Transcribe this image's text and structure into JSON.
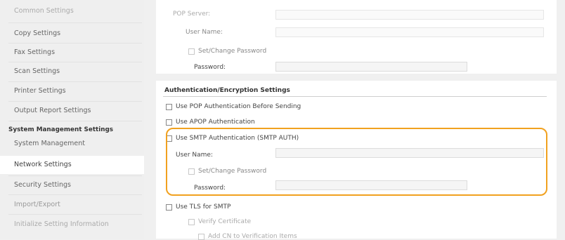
{
  "sidebar": {
    "items": [
      {
        "label": "Common Settings"
      },
      {
        "label": "Copy Settings"
      },
      {
        "label": "Fax Settings"
      },
      {
        "label": "Scan Settings"
      },
      {
        "label": "Printer Settings"
      },
      {
        "label": "Output Report Settings"
      }
    ],
    "section_header": "System Management Settings",
    "sub_items": [
      {
        "label": "System Management"
      },
      {
        "label": "Network Settings"
      },
      {
        "label": "Security Settings"
      },
      {
        "label": "Import/Export"
      },
      {
        "label": "Initialize Setting Information"
      }
    ]
  },
  "pop": {
    "server_label": "POP Server:",
    "username_label": "User Name:",
    "set_change_password_label": "Set/Change Password",
    "password_label": "Password:"
  },
  "auth": {
    "section_title": "Authentication/Encryption Settings",
    "pop_before_sending_label": "Use POP Authentication Before Sending",
    "apop_label": "Use APOP Authentication",
    "smtp_auth_label": "Use SMTP Authentication (SMTP AUTH)",
    "smtp_username_label": "User Name:",
    "smtp_set_change_password_label": "Set/Change Password",
    "smtp_password_label": "Password:",
    "tls_label": "Use TLS for SMTP",
    "verify_cert_label": "Verify Certificate",
    "add_cn_label": "Add CN to Verification Items"
  },
  "colors": {
    "highlight": "#f1a11f",
    "sidebar_bg": "#efefef",
    "active_bg": "#ffffff"
  }
}
